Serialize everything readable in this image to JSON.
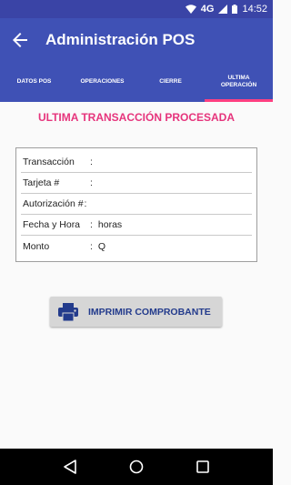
{
  "status_bar": {
    "network": "4G",
    "time": "14:52",
    "icons": [
      "wifi-icon",
      "signal-icon",
      "battery-icon"
    ]
  },
  "app_bar": {
    "title": "Administración POS",
    "back_icon": "arrow-back-icon"
  },
  "tabs": [
    {
      "label": "DATOS POS",
      "active": false
    },
    {
      "label": "OPERACIONES",
      "active": false
    },
    {
      "label": "CIERRE",
      "active": false
    },
    {
      "label": "ULTIMA OPERACIÓN",
      "active": true
    }
  ],
  "heading": "ULTIMA TRANSACCIÓN PROCESADA",
  "fields": [
    {
      "label": "Transacción",
      "sep": ":",
      "value": ""
    },
    {
      "label": "Tarjeta #",
      "sep": ":",
      "value": ""
    },
    {
      "label": "Autorización #",
      "sep": ":",
      "value": ""
    },
    {
      "label": "Fecha y Hora",
      "sep": ":",
      "value": "horas"
    },
    {
      "label": "Monto",
      "sep": ":",
      "value": "Q"
    }
  ],
  "print_button": {
    "label": "IMPRIMIR COMPROBANTE",
    "icon": "printer-icon"
  },
  "colors": {
    "primary": "#3f51b5",
    "status_bar": "#3a44a6",
    "accent": "#ff4081",
    "heading": "#e6347c",
    "button_text": "#233b8c"
  },
  "nav_bar": {
    "icons": [
      "nav-back-icon",
      "nav-home-icon",
      "nav-recents-icon"
    ]
  }
}
